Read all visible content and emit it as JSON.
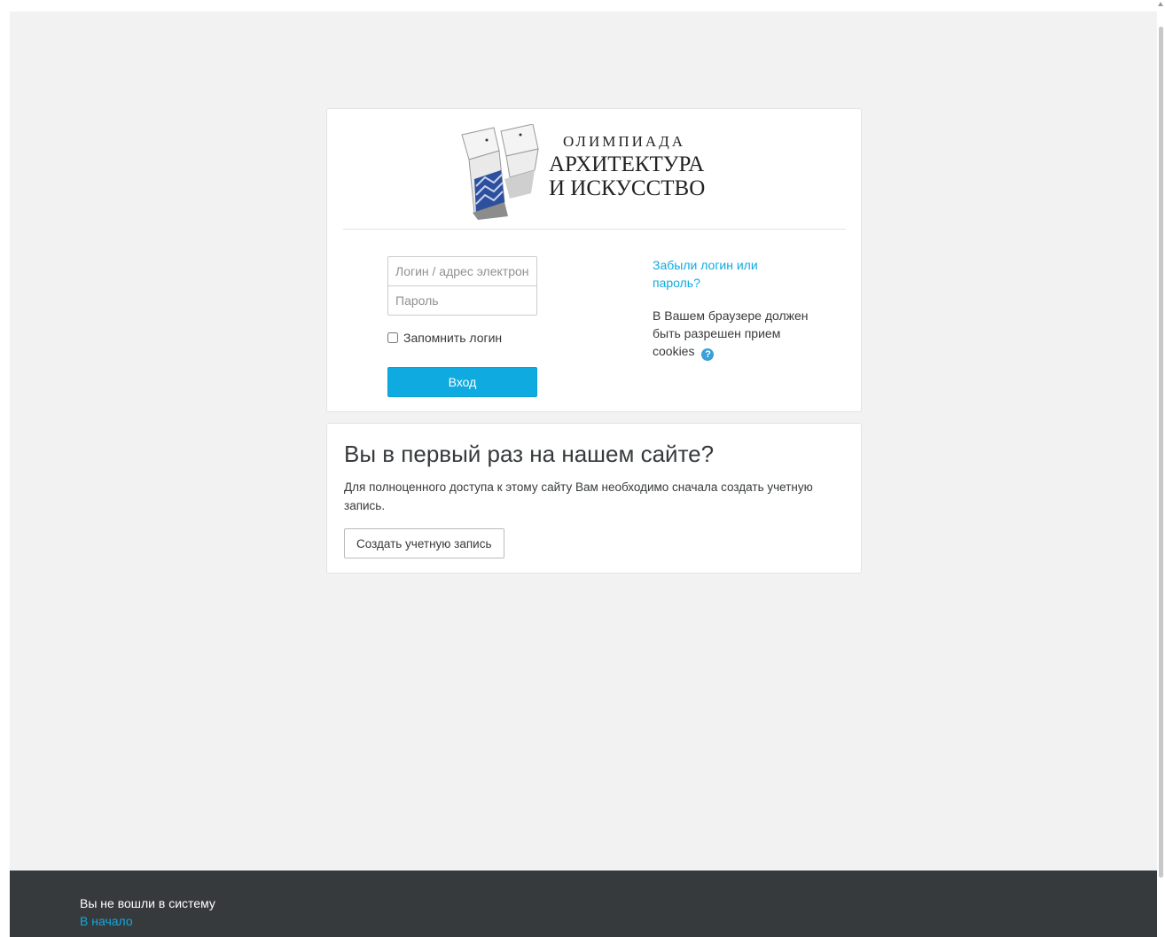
{
  "logo": {
    "line1": "ОЛИМПИАДА",
    "line2": "АРХИТЕКТУРА",
    "line3": "И ИСКУССТВО"
  },
  "login": {
    "username_placeholder": "Логин / адрес электронной почты",
    "password_placeholder": "Пароль",
    "remember_label": "Запомнить логин",
    "submit_label": "Вход",
    "forgot_link": "Забыли логин или пароль?",
    "cookies_note": "В Вашем браузере должен быть разрешен прием cookies",
    "help_icon": "question-circle"
  },
  "signup": {
    "title": "Вы в первый раз на нашем сайте?",
    "description": "Для полноценного доступа к этому сайту Вам необходимо сначала создать учетную запись.",
    "button_label": "Создать учетную запись"
  },
  "footer": {
    "status": "Вы не вошли в систему",
    "home_link": "В начало"
  },
  "colors": {
    "accent": "#0faadf",
    "footer_bg": "#373a3c",
    "page_bg": "#f2f2f2"
  }
}
